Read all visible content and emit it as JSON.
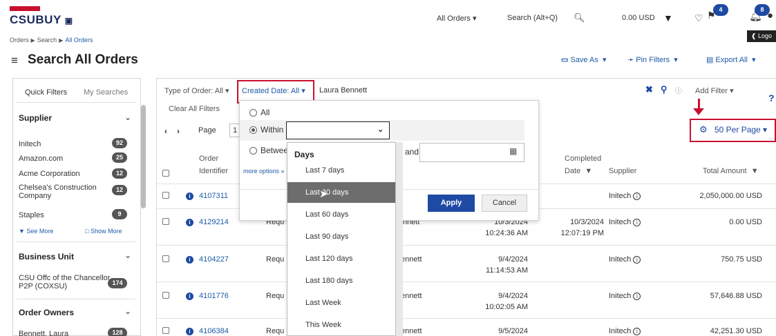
{
  "app": {
    "logo_text": "CSUBUY",
    "logo_badge": "The California State University"
  },
  "topnav": {
    "all_orders": "All Orders ▾",
    "search": "Search (Alt+Q)",
    "amount": "0.00 USD",
    "msg_count": "4",
    "notif_count": "8",
    "logout": "Logo"
  },
  "breadcrumb": {
    "orders": "Orders",
    "search": "Search",
    "all_orders": "All Orders"
  },
  "header": {
    "title": "Search All Orders",
    "save_as": "Save As",
    "pin_filters": "Pin Filters",
    "export_all": "Export All"
  },
  "sidebar": {
    "tab_quick": "Quick Filters",
    "tab_my": "My Searches",
    "supplier_head": "Supplier",
    "suppliers": [
      {
        "name": "Initech",
        "count": "92"
      },
      {
        "name": "Amazon.com",
        "count": "25"
      },
      {
        "name": "Acme Corporation",
        "count": "12"
      },
      {
        "name": "Chelsea's Construction Company",
        "count": "12"
      },
      {
        "name": "Staples",
        "count": "9"
      }
    ],
    "see_more": "See More",
    "show_more": "Show More",
    "bu_head": "Business Unit",
    "bu_item": "CSU Offc of the Chancellor P2P (COXSU)",
    "bu_count": "174",
    "owners_head": "Order Owners",
    "owner_item": "Bennett, Laura",
    "owner_count": "128"
  },
  "filters": {
    "type": "Type of Order: All ▾",
    "created": "Created Date: All ▾",
    "keyword": "Laura Bennett",
    "add_filter": "Add Filter ▾",
    "clear_all": "Clear All Filters",
    "help": "?"
  },
  "pager": {
    "page_label": "Page",
    "page_value": "1",
    "per_page": "50 Per Page ▾"
  },
  "columns": {
    "order_id_1": "Order",
    "order_id_2": "Identifier",
    "completed_1": "Completed",
    "completed_2": "Date",
    "supplier": "Supplier",
    "total": "Total Amount"
  },
  "rows": [
    {
      "id": "4107311",
      "type": "",
      "owner": "",
      "date1": "",
      "time1": "",
      "completed": "",
      "completed_time": "",
      "supplier": "Initech",
      "total": "2,050,000.00 USD"
    },
    {
      "id": "4129214",
      "type": "Requ",
      "owner": "nnett",
      "date1": "10/3/2024",
      "time1": "10:24:36 AM",
      "completed": "10/3/2024",
      "completed_time": "12:07:19 PM",
      "supplier": "Initech",
      "total": "0.00 USD"
    },
    {
      "id": "4104227",
      "type": "Requ",
      "owner": "ennett",
      "date1": "9/4/2024",
      "time1": "11:14:53 AM",
      "completed": "",
      "completed_time": "",
      "supplier": "Initech",
      "total": "750.75 USD"
    },
    {
      "id": "4101776",
      "type": "Requ",
      "owner": "ennett",
      "date1": "9/4/2024",
      "time1": "10:02:05 AM",
      "completed": "",
      "completed_time": "",
      "supplier": "Initech",
      "total": "57,646.88 USD"
    },
    {
      "id": "4106384",
      "type": "Requ",
      "owner": "ennett",
      "date1": "9/5/2024",
      "time1": "",
      "completed": "",
      "completed_time": "",
      "supplier": "Initech",
      "total": "42,251.30 USD"
    }
  ],
  "date_popover": {
    "all": "All",
    "within": "Within",
    "between": "Betwee",
    "and": "and",
    "more_options": "more options »",
    "apply": "Apply",
    "cancel": "Cancel"
  },
  "days_dropdown": {
    "header": "Days",
    "options": [
      "Last 7 days",
      "Last 30 days",
      "Last 60 days",
      "Last 90 days",
      "Last 120 days",
      "Last 180 days",
      "Last Week",
      "This Week"
    ],
    "highlighted_index": 1
  },
  "colors": {
    "brand_blue": "#1e4aa3",
    "annotation_red": "#c8102e",
    "highlight_gray": "#6d6d6d"
  }
}
